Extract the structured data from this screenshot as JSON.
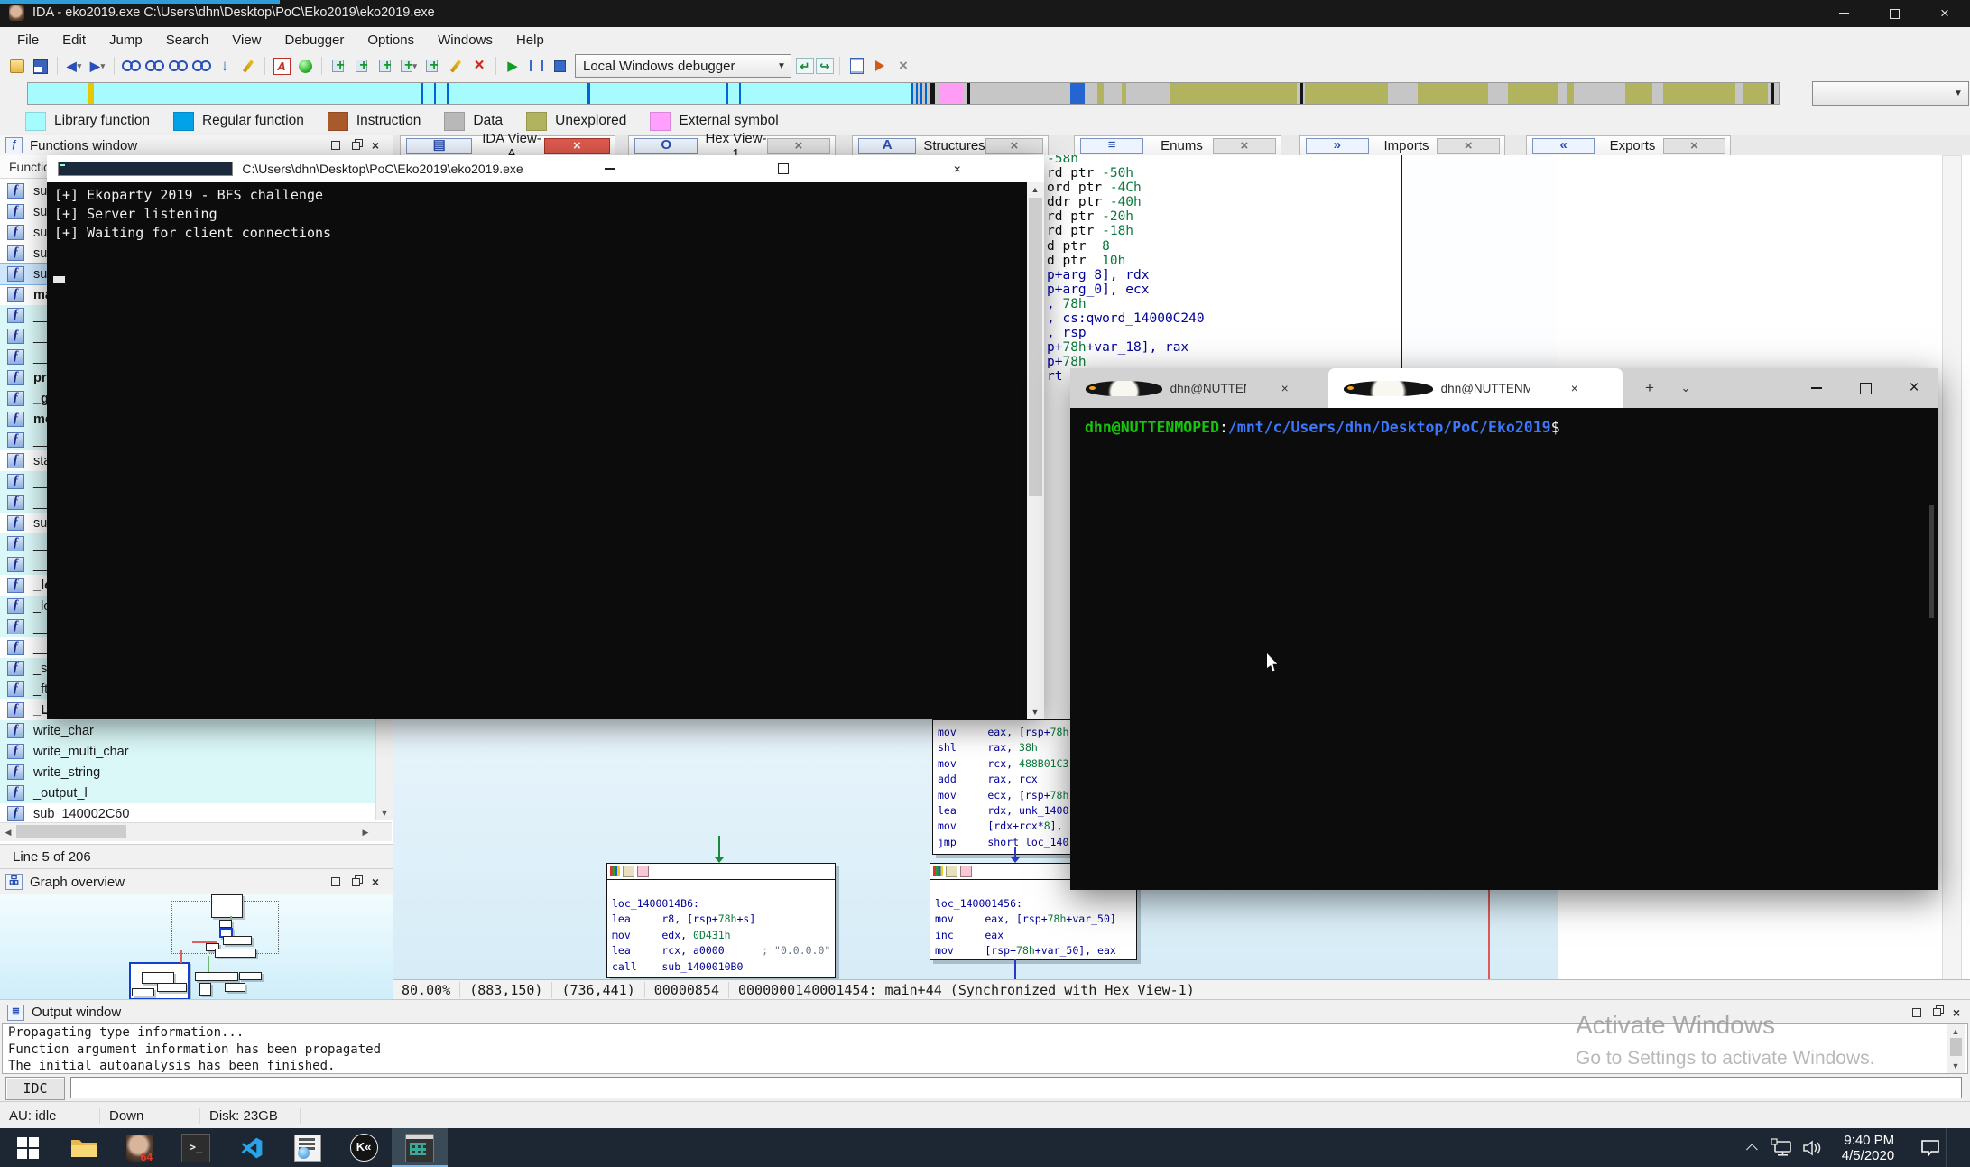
{
  "titlebar": {
    "title": "IDA - eko2019.exe C:\\Users\\dhn\\Desktop\\PoC\\Eko2019\\eko2019.exe"
  },
  "menu": {
    "items": [
      "File",
      "Edit",
      "Jump",
      "Search",
      "View",
      "Debugger",
      "Options",
      "Windows",
      "Help"
    ]
  },
  "toolbar": {
    "debugger_combo": "Local Windows debugger"
  },
  "legend": {
    "items": [
      {
        "label": "Library function",
        "sw": "background:#a6fbff"
      },
      {
        "label": "Regular function",
        "sw": "background:#00a2e8"
      },
      {
        "label": "Instruction",
        "sw": "background:#a85a2a"
      },
      {
        "label": "Data",
        "sw": "background:#b8b8b8"
      },
      {
        "label": "Unexplored",
        "sw": "background:#b2b35e"
      },
      {
        "label": "External symbol",
        "sw": "background:#ffa0ff"
      }
    ]
  },
  "navband": {
    "segments": [
      {
        "s": "left:0px;width:978px;background:#a6fbff"
      },
      {
        "s": "left:66px;width:7px;background:#e6c800"
      },
      {
        "s": "left:436px;width:2px;background:#0066d6"
      },
      {
        "s": "left:450px;width:2px;background:#0066d6"
      },
      {
        "s": "left:464px;width:2px;background:#0066d6"
      },
      {
        "s": "left:620px;width:3px;background:#0066d6"
      },
      {
        "s": "left:774px;width:2px;background:#0066d6"
      },
      {
        "s": "left:788px;width:2px;background:#0066d6"
      },
      {
        "s": "left:978px;width:3px;background:#0066d6"
      },
      {
        "s": "left:984px;width:2px;background:#0066d6"
      },
      {
        "s": "left:989px;width:2px;background:#0066d6"
      },
      {
        "s": "left:994px;width:2px;background:#0066d6"
      },
      {
        "s": "left:1000px;width:5px;background:#151515"
      },
      {
        "s": "left:1010px;width:26px;background:#ff9cf6"
      },
      {
        "s": "left:1040px;width:4px;background:#151515"
      },
      {
        "s": "left:1155px;width:16px;background:#2565d2"
      },
      {
        "s": "left:1185px;width:7px;background:#b2b35e"
      },
      {
        "s": "left:1212px;width:5px;background:#b2b35e"
      },
      {
        "s": "left:1266px;width:140px;background:#b2b35e"
      },
      {
        "s": "left:1410px;width:3px;background:#151515"
      },
      {
        "s": "left:1415px;width:92px;background:#b2b35e"
      },
      {
        "s": "left:1540px;width:78px;background:#b2b35e"
      },
      {
        "s": "left:1640px;width:55px;background:#b2b35e"
      },
      {
        "s": "left:1705px;width:8px;background:#b2b35e"
      },
      {
        "s": "left:1770px;width:30px;background:#b2b35e"
      },
      {
        "s": "left:1812px;width:80px;background:#b2b35e"
      },
      {
        "s": "left:1900px;width:28px;background:#b2b35e"
      },
      {
        "s": "left:1932px;width:3px;background:#151515"
      }
    ]
  },
  "panels": {
    "functions_title": "Functions window",
    "functions_colhead": "Function name",
    "graph_overview_title": "Graph overview",
    "output_title": "Output window",
    "line_status": "Line 5 of 206"
  },
  "tabs": [
    {
      "label": "IDA View-A",
      "ic": "▤"
    },
    {
      "label": "Hex View-1",
      "ic": "O"
    },
    {
      "label": "Structures",
      "ic": "A"
    },
    {
      "label": "Enums",
      "ic": "≡"
    },
    {
      "label": "Imports",
      "ic": "»"
    },
    {
      "label": "Exports",
      "ic": "«"
    }
  ],
  "functions": {
    "rows": [
      {
        "label": "sub",
        "cls": ""
      },
      {
        "label": "sub",
        "cls": ""
      },
      {
        "label": "sub",
        "cls": ""
      },
      {
        "label": "sub",
        "cls": ""
      },
      {
        "label": "sub",
        "cls": "sel"
      },
      {
        "label": "main",
        "cls": "b"
      },
      {
        "label": "__",
        "cls": "hl"
      },
      {
        "label": "__",
        "cls": "hl"
      },
      {
        "label": "__",
        "cls": "hl"
      },
      {
        "label": "pri",
        "cls": "hl b"
      },
      {
        "label": "_g",
        "cls": "hl b"
      },
      {
        "label": "me",
        "cls": "hl b"
      },
      {
        "label": "__t",
        "cls": "hl"
      },
      {
        "label": "sta",
        "cls": ""
      },
      {
        "label": "__",
        "cls": "hl"
      },
      {
        "label": "__",
        "cls": "hl"
      },
      {
        "label": "sub",
        "cls": ""
      },
      {
        "label": "__i",
        "cls": "hl"
      },
      {
        "label": "__e",
        "cls": "hl"
      },
      {
        "label": "_lo",
        "cls": "b"
      },
      {
        "label": "_lo",
        "cls": "hl"
      },
      {
        "label": "__u",
        "cls": "hl"
      },
      {
        "label": "__u",
        "cls": ""
      },
      {
        "label": "_st",
        "cls": "hl"
      },
      {
        "label": "_ft",
        "cls": "hl"
      },
      {
        "label": "_Lo",
        "cls": "b"
      },
      {
        "label": "write_char",
        "cls": "hl"
      },
      {
        "label": "write_multi_char",
        "cls": "hl"
      },
      {
        "label": "write_string",
        "cls": "hl"
      },
      {
        "label": "_output_l",
        "cls": "hl"
      },
      {
        "label": "sub_140002C60",
        "cls": ""
      }
    ]
  },
  "asm_strip": {
    "lines": [
      {
        "t": "-58h",
        "cls": "s"
      },
      {
        "t": "rd ptr -50h",
        "cls": "s"
      },
      {
        "t": "ord ptr -4Ch",
        "cls": "s"
      },
      {
        "t": "ddr ptr -40h",
        "cls": "s"
      },
      {
        "t": "rd ptr -20h",
        "cls": "s"
      },
      {
        "t": "rd ptr -18h",
        "cls": "s"
      },
      {
        "t": "d ptr  8",
        "cls": "s"
      },
      {
        "t": "d ptr  10h",
        "cls": "s"
      },
      {
        "t": "",
        "cls": "s"
      },
      {
        "t": "p+arg_8], rdx",
        "cls": "c"
      },
      {
        "t": "p+arg_0], ecx",
        "cls": "c"
      },
      {
        "t": ", 78h",
        "cls": "c"
      },
      {
        "t": ", cs:qword_14000C240",
        "cls": "c"
      },
      {
        "t": ", rsp",
        "cls": "c"
      },
      {
        "t": "p+78h+var_18], rax",
        "cls": "c"
      },
      {
        "t": "p+78h",
        "cls": "c"
      },
      {
        "t": "rt lo",
        "cls": "c"
      }
    ]
  },
  "graph_nodes": {
    "node1": {
      "lines": [
        "loc_1400014B6:",
        "lea     r8, [rsp+78h+s]",
        "mov     edx, 0D431h",
        "lea     rcx, a0000      ; \"0.0.0.0\"",
        "call    sub_1400010B0"
      ]
    },
    "node2": {
      "lines": [
        "loc_140001456:",
        "mov     eax, [rsp+78h+var_50]",
        "inc     eax",
        "mov     [rsp+78h+var_50], eax"
      ]
    },
    "node3": {
      "lines": [
        "mov     eax, [rsp+78h",
        "shl     rax, 38h",
        "mov     rcx, 488B01C3",
        "add     rax, rcx",
        "mov     ecx, [rsp+78h",
        "lea     rdx, unk_1400",
        "mov     [rdx+rcx*8],",
        "jmp     short loc_140"
      ]
    }
  },
  "go_thumbnail": {
    "boxes": [
      {
        "s": "left:190px;top:7px;width:117px;height:57px;border:1px dotted #666;background:transparent;box-shadow:none"
      },
      {
        "s": "left:234px;top:0px;width:33px;height:24px"
      },
      {
        "s": "left:243px;top:28px;width:12px;height:7px"
      },
      {
        "s": "left:243px;top:37px;width:11px;height:7px;border:2px solid #1040d0"
      },
      {
        "s": "left:247px;top:46px;width:30px;height:8px"
      },
      {
        "s": "left:228px;top:54px;width:13px;height:7px"
      },
      {
        "s": "left:238px;top:60px;width:44px;height:8px"
      },
      {
        "s": "left:143px;top:75px;width:63px;height:38px;border:2px solid #1040d0"
      },
      {
        "s": "left:157px;top:86px;width:34px;height:11px"
      },
      {
        "s": "left:174px;top:98px;width:31px;height:8px"
      },
      {
        "s": "left:146px;top:104px;width:23px;height:7px"
      },
      {
        "s": "left:216px;top:86px;width:46px;height:8px"
      },
      {
        "s": "left:265px;top:86px;width:23px;height:7px"
      },
      {
        "s": "left:221px;top:98px;width:11px;height:12px"
      },
      {
        "s": "left:249px;top:98px;width:21px;height:8px"
      },
      {
        "s": "left:213px;top:52px;width:28px;height:2px;background:#e06060;border:none;box-shadow:none"
      },
      {
        "s": "left:200px;top:62px;width:2px;height:14px;background:#e06060;border:none;box-shadow:none"
      },
      {
        "s": "left:230px;top:68px;width:2px;height:18px;background:#6db66d;border:none;box-shadow:none"
      },
      {
        "s": "left:255px;top:24px;width:2px;height:4px;background:#6db66d;border:none;box-shadow:none"
      }
    ]
  },
  "statusbar": {
    "segments": [
      "80.00%",
      "(883,150)",
      "(736,441)",
      "00000854",
      "0000000140001454: main+44 (Synchronized with Hex View-1)"
    ]
  },
  "output": {
    "lines": [
      "Propagating type information...",
      "Function argument information has been propagated",
      "The initial autoanalysis has been finished."
    ],
    "idc_label": "IDC",
    "idc_value": "",
    "status_cells": [
      "AU: idle",
      "Down",
      "Disk: 23GB"
    ]
  },
  "console": {
    "title": "C:\\Users\\dhn\\Desktop\\PoC\\Eko2019\\eko2019.exe",
    "lines": [
      "[+] Ekoparty 2019 - BFS challenge",
      "[+] Server listening",
      "[+] Waiting for client connections"
    ]
  },
  "terminal": {
    "tab1": "dhn@NUTTENMOPED: /mnt/c/l",
    "tab2": "dhn@NUTTENMOPED: /mnt/c/l",
    "new_tab": "+",
    "prompt": {
      "user": "dhn@NUTTENMOPED",
      "colon": ":",
      "path": "/mnt/c/Users/dhn/Desktop/PoC/Eko2019",
      "dollar": "$"
    }
  },
  "watermark": {
    "line1": "Activate Windows",
    "line2": "Go to Settings to activate Windows."
  },
  "taskbar": {
    "icons": [
      {
        "n": "start-icon",
        "cls": "tb-start"
      },
      {
        "n": "file-explorer-icon",
        "cls": "tb-explorer"
      },
      {
        "n": "ida-icon",
        "cls": "tb-ida"
      },
      {
        "n": "command-prompt-icon",
        "cls": "tb-cmd"
      },
      {
        "n": "vscode-icon",
        "cls": "tb-vscode"
      },
      {
        "n": "hex-editor-icon",
        "cls": "tb-hex"
      },
      {
        "n": "keepass-icon",
        "cls": "tb-k"
      },
      {
        "n": "windows-terminal-icon",
        "cls": "tb-wt active"
      }
    ],
    "clock": {
      "time": "9:40 PM",
      "date": "4/5/2020"
    }
  }
}
